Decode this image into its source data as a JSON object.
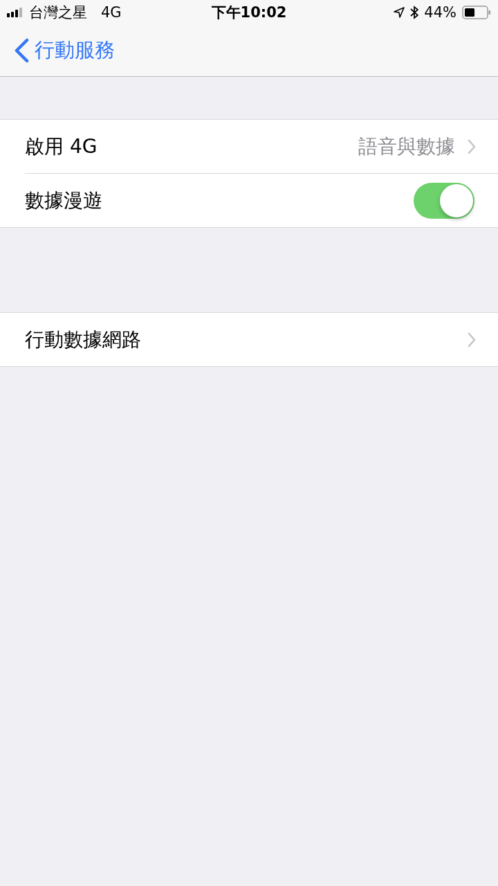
{
  "status_bar": {
    "carrier": "台灣之星",
    "network": "4G",
    "time": "下午10:02",
    "battery_percent": "44%"
  },
  "nav": {
    "back_label": "行動服務"
  },
  "groups": [
    {
      "rows": [
        {
          "kind": "disclosure",
          "label": "啟用 4G",
          "value": "語音與數據"
        },
        {
          "kind": "toggle",
          "label": "數據漫遊",
          "on": true
        }
      ]
    },
    {
      "rows": [
        {
          "kind": "disclosure",
          "label": "行動數據網路"
        }
      ]
    }
  ]
}
